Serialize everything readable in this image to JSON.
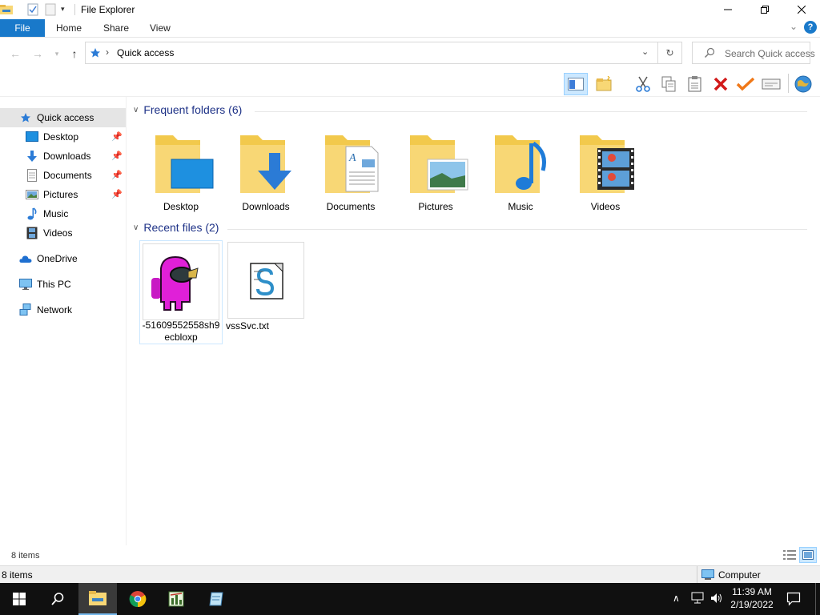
{
  "window": {
    "title": "File Explorer"
  },
  "ribbon": {
    "tabs": [
      "File",
      "Home",
      "Share",
      "View"
    ]
  },
  "address": {
    "path_item": "Quick access",
    "search_placeholder": "Search Quick access"
  },
  "nav": {
    "quick_access": "Quick access",
    "items": [
      {
        "label": "Desktop",
        "icon": "desktop-icon",
        "pinned": true
      },
      {
        "label": "Downloads",
        "icon": "downloads-icon",
        "pinned": true
      },
      {
        "label": "Documents",
        "icon": "documents-icon",
        "pinned": true
      },
      {
        "label": "Pictures",
        "icon": "pictures-icon",
        "pinned": true
      },
      {
        "label": "Music",
        "icon": "music-icon",
        "pinned": false
      },
      {
        "label": "Videos",
        "icon": "videos-icon",
        "pinned": false
      }
    ],
    "onedrive": "OneDrive",
    "thispc": "This PC",
    "network": "Network"
  },
  "content": {
    "frequent_header": "Frequent folders (6)",
    "folders": [
      {
        "label": "Desktop",
        "icon": "desktop-folder-icon"
      },
      {
        "label": "Downloads",
        "icon": "downloads-folder-icon"
      },
      {
        "label": "Documents",
        "icon": "documents-folder-icon"
      },
      {
        "label": "Pictures",
        "icon": "pictures-folder-icon"
      },
      {
        "label": "Music",
        "icon": "music-folder-icon"
      },
      {
        "label": "Videos",
        "icon": "videos-folder-icon"
      }
    ],
    "recent_header": "Recent files (2)",
    "files": [
      {
        "label": "-51609552558sh9ecbloxp",
        "icon": "image-thumbnail-icon"
      },
      {
        "label": "vssSvc.txt",
        "icon": "text-file-icon"
      }
    ]
  },
  "status": {
    "items_count": "8 items",
    "items_count_bottom": "8 items",
    "zone": "Computer"
  },
  "taskbar": {
    "time": "11:39 AM",
    "date": "2/19/2022"
  },
  "colors": {
    "accent": "#1979ca",
    "folder": "#f8d775",
    "group_header": "#1e3287",
    "selection": "#cce8ff"
  }
}
